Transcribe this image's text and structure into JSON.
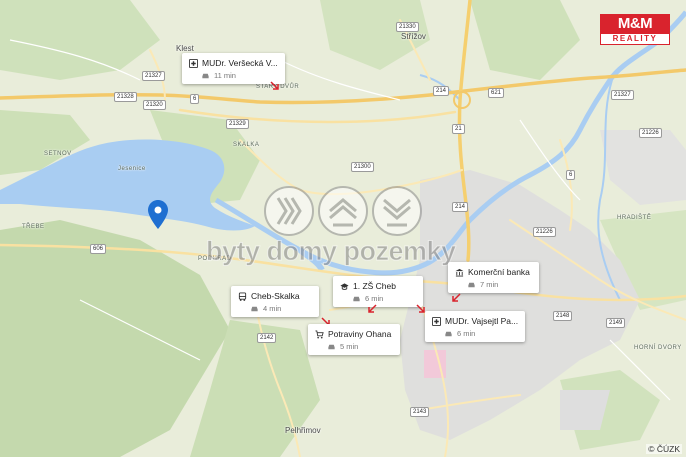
{
  "watermark": {
    "text": "byty domy pozemky"
  },
  "brand": {
    "top": "M&M",
    "bottom": "REALITY"
  },
  "copyright": "© ČÚZK",
  "places": {
    "klest": "Klest",
    "strizov": "Střížov",
    "setnov": "SETNOV",
    "skalka": "SKALKA",
    "podhrad": "PODHRAD",
    "trebe": "TŘEBE",
    "hradiste": "HRADIŠTĚ",
    "horni_dvory": "HORNÍ DVORY",
    "pelhrimov": "Pelhřimov",
    "stary_dvur": "STARÝ DVŮR",
    "lake": "Jesenice"
  },
  "roads": {
    "r21330": "21330",
    "r21327a": "21327",
    "r21328": "21328",
    "r21320": "21320",
    "r6a": "6",
    "r21329": "21329",
    "r21300": "21300",
    "r214a": "214",
    "r21b": "21",
    "r621": "621",
    "r21327b": "21327",
    "r21226": "21226",
    "r6b": "6",
    "r21226b": "21226",
    "r606": "606",
    "r214c": "214",
    "r2148": "2148",
    "r2149": "2149",
    "r2142": "2142",
    "r2143": "2143"
  },
  "pois": [
    {
      "id": "versecka",
      "title": "MUDr. Veršecká V...",
      "mode": "car",
      "time": "11 min",
      "icon": "medical-icon"
    },
    {
      "id": "skalka",
      "title": "Cheb-Skalka",
      "mode": "car",
      "time": "4 min",
      "icon": "bus-icon"
    },
    {
      "id": "zs",
      "title": "1. ZŠ Cheb",
      "mode": "car",
      "time": "6 min",
      "icon": "school-icon"
    },
    {
      "id": "banka",
      "title": "Komerční banka",
      "mode": "car",
      "time": "7 min",
      "icon": "bank-icon"
    },
    {
      "id": "vajsejtl",
      "title": "MUDr. Vajsejtl Pa...",
      "mode": "car",
      "time": "6 min",
      "icon": "medical-icon"
    },
    {
      "id": "ohana",
      "title": "Potraviny Ohana",
      "mode": "car",
      "time": "5 min",
      "icon": "cart-icon"
    }
  ],
  "colors": {
    "water": "#a9cdf2",
    "forest": "#c7dcb0",
    "urban": "#dcdcdc",
    "road": "#f7d27c",
    "pin": "#1f6fd1",
    "brand_red": "#d9232d"
  }
}
